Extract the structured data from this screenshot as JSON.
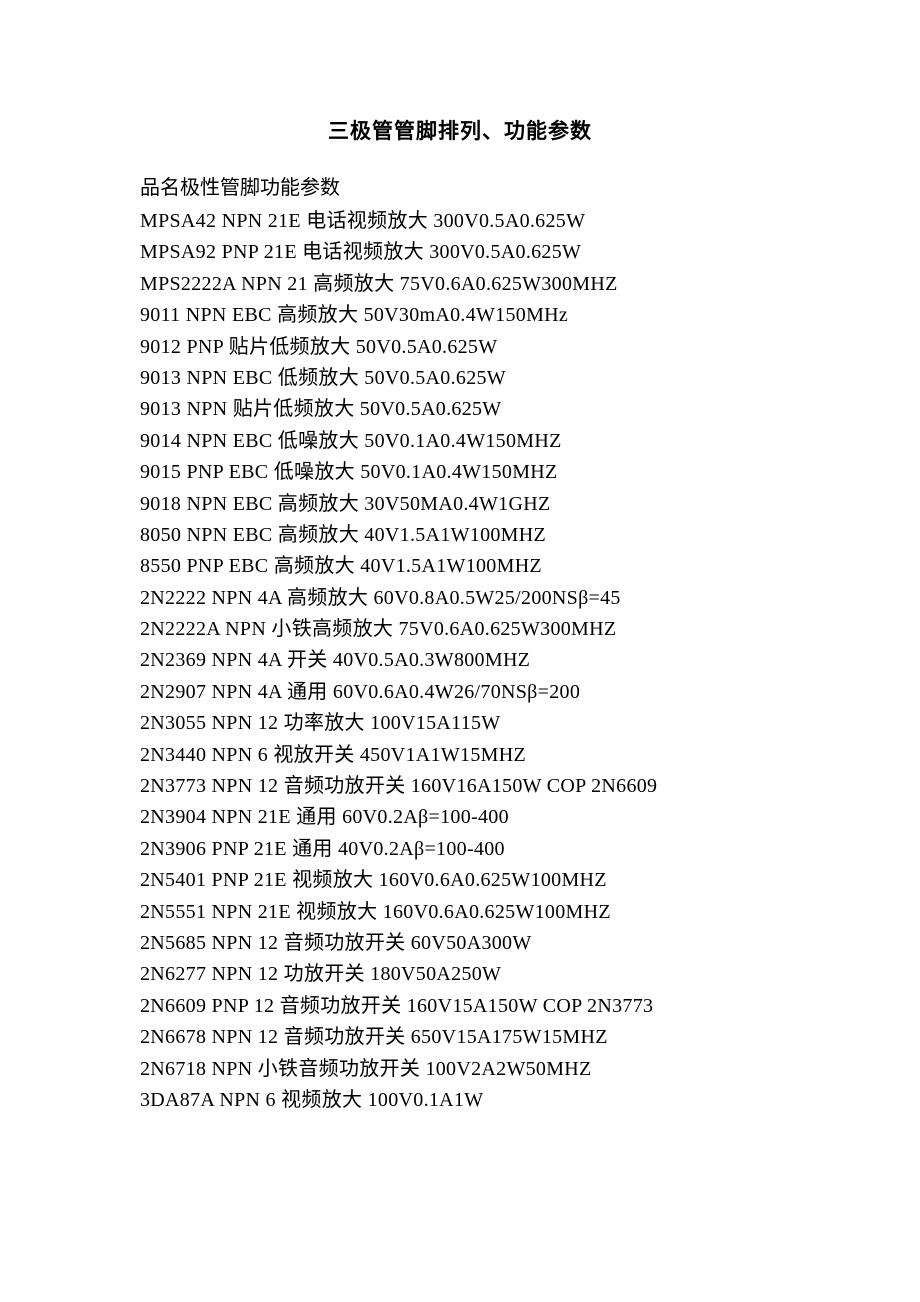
{
  "title": "三极管管脚排列、功能参数",
  "header": "品名极性管脚功能参数",
  "rows": [
    "MPSA42 NPN 21E 电话视频放大 300V0.5A0.625W",
    "MPSA92 PNP 21E 电话视频放大 300V0.5A0.625W",
    "MPS2222A NPN 21 高频放大 75V0.6A0.625W300MHZ",
    "9011 NPN EBC 高频放大 50V30mA0.4W150MHz",
    "9012 PNP 贴片低频放大 50V0.5A0.625W",
    "9013 NPN EBC 低频放大 50V0.5A0.625W",
    "9013 NPN 贴片低频放大 50V0.5A0.625W",
    "9014 NPN EBC 低噪放大 50V0.1A0.4W150MHZ",
    "9015 PNP EBC 低噪放大 50V0.1A0.4W150MHZ",
    "9018 NPN EBC 高频放大 30V50MA0.4W1GHZ",
    "8050 NPN EBC 高频放大 40V1.5A1W100MHZ",
    "8550 PNP EBC 高频放大 40V1.5A1W100MHZ",
    "2N2222 NPN 4A 高频放大 60V0.8A0.5W25/200NSβ=45",
    "2N2222A NPN 小铁高频放大 75V0.6A0.625W300MHZ",
    "2N2369 NPN 4A 开关 40V0.5A0.3W800MHZ",
    "2N2907 NPN 4A 通用 60V0.6A0.4W26/70NSβ=200",
    "2N3055 NPN 12 功率放大 100V15A115W",
    "2N3440 NPN 6 视放开关 450V1A1W15MHZ",
    "2N3773 NPN 12 音频功放开关 160V16A150W COP 2N6609",
    "2N3904 NPN 21E 通用 60V0.2Aβ=100-400",
    "2N3906 PNP 21E 通用 40V0.2Aβ=100-400",
    "2N5401 PNP 21E 视频放大 160V0.6A0.625W100MHZ",
    "2N5551 NPN 21E 视频放大 160V0.6A0.625W100MHZ",
    "2N5685 NPN 12 音频功放开关 60V50A300W",
    "2N6277 NPN 12 功放开关 180V50A250W",
    "2N6609 PNP 12 音频功放开关 160V15A150W COP 2N3773",
    "2N6678 NPN 12 音频功放开关 650V15A175W15MHZ",
    "2N6718 NPN 小铁音频功放开关 100V2A2W50MHZ",
    "3DA87A NPN 6 视频放大 100V0.1A1W"
  ]
}
